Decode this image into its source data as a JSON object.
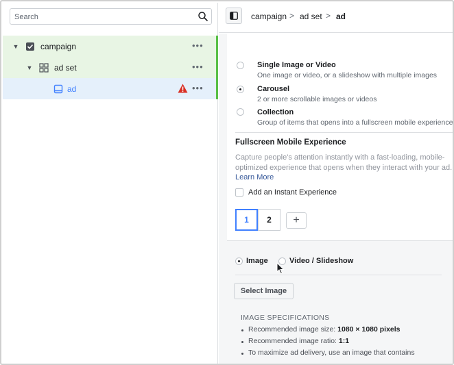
{
  "search": {
    "placeholder": "Search"
  },
  "tree": {
    "campaign": {
      "label": "campaign",
      "more": "•••"
    },
    "adset": {
      "label": "ad set",
      "more": "•••"
    },
    "ad": {
      "label": "ad",
      "more": "•••"
    }
  },
  "breadcrumb": {
    "items": [
      "campaign",
      "ad set",
      "ad"
    ],
    "separator": ">"
  },
  "format_options": [
    {
      "title": "Single Image or Video",
      "desc": "One image or video, or a slideshow with multiple images",
      "selected": false
    },
    {
      "title": "Carousel",
      "desc": "2 or more scrollable images or videos",
      "selected": true
    },
    {
      "title": "Collection",
      "desc": "Group of items that opens into a fullscreen mobile experience",
      "selected": false
    }
  ],
  "fullscreen": {
    "title": "Fullscreen Mobile Experience",
    "desc_line1": "Capture people's attention instantly with a fast-loading, mobile-",
    "desc_line2": "optimized experience that opens when they interact with your ad.",
    "learn_more": "Learn More",
    "instant_label": "Add an Instant Experience"
  },
  "cards": {
    "tabs": [
      "1",
      "2"
    ],
    "add": "+"
  },
  "media": {
    "image_label": "Image",
    "video_label": "Video / Slideshow",
    "select_button": "Select Image",
    "spec_heading": "IMAGE SPECIFICATIONS",
    "spec1_text": "Recommended image size: ",
    "spec1_value": "1080 × 1080 pixels",
    "spec2_text": "Recommended image ratio: ",
    "spec2_value": "1:1",
    "spec3_text": "To maximize ad delivery, use an image that contains"
  },
  "colors": {
    "accent": "#4080ff",
    "green": "#58c046",
    "warning": "#d93025",
    "link": "#365899"
  },
  "icons": [
    "search-icon",
    "caret-down-icon",
    "campaign-checkbox-icon",
    "adset-grid-icon",
    "ad-preview-icon",
    "warning-icon",
    "more-icon",
    "panel-toggle-icon",
    "cursor-icon"
  ]
}
